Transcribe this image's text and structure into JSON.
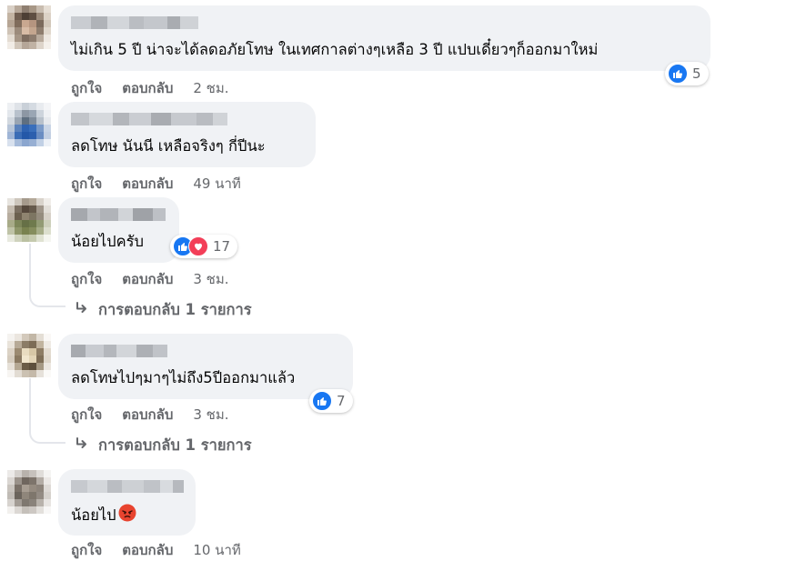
{
  "comments": [
    {
      "text": "ไม่เกิน 5 ปี น่าจะได้ลดอภัยโทษ ในเทศกาลต่างๆเหลือ 3 ปี แปบเดี๋ยวๆก็ออกมาใหม่",
      "reaction_count": "5",
      "reactions": [
        "like"
      ],
      "like_label": "ถูกใจ",
      "reply_label": "ตอบกลับ",
      "time": "2 ชม."
    },
    {
      "text": "ลดโทษ นันนี เหลือจริงๆ กี่ปีนะ",
      "like_label": "ถูกใจ",
      "reply_label": "ตอบกลับ",
      "time": "49 นาที"
    },
    {
      "text": "น้อยไปครับ",
      "reaction_count": "17",
      "reactions": [
        "like",
        "love"
      ],
      "like_label": "ถูกใจ",
      "reply_label": "ตอบกลับ",
      "time": "3 ชม.",
      "replies_label": "การตอบกลับ 1 รายการ"
    },
    {
      "text": "ลดโทษไปๆมาๆไม่ถึง5ปีออกมาแล้ว",
      "reaction_count": "7",
      "reactions": [
        "like"
      ],
      "like_label": "ถูกใจ",
      "reply_label": "ตอบกลับ",
      "time": "3 ชม.",
      "replies_label": "การตอบกลับ 1 รายการ"
    },
    {
      "text": "น้อยไป",
      "inline_emoji": "angry-face-icon",
      "like_label": "ถูกใจ",
      "reply_label": "ตอบกลับ",
      "time": "10 นาที"
    }
  ],
  "colors": {
    "bubble": "#f0f2f5",
    "secondary_text": "#65676b",
    "like_blue": "#1877f2",
    "love_red": "#f33e58",
    "angry_orange": "#f7714c"
  }
}
